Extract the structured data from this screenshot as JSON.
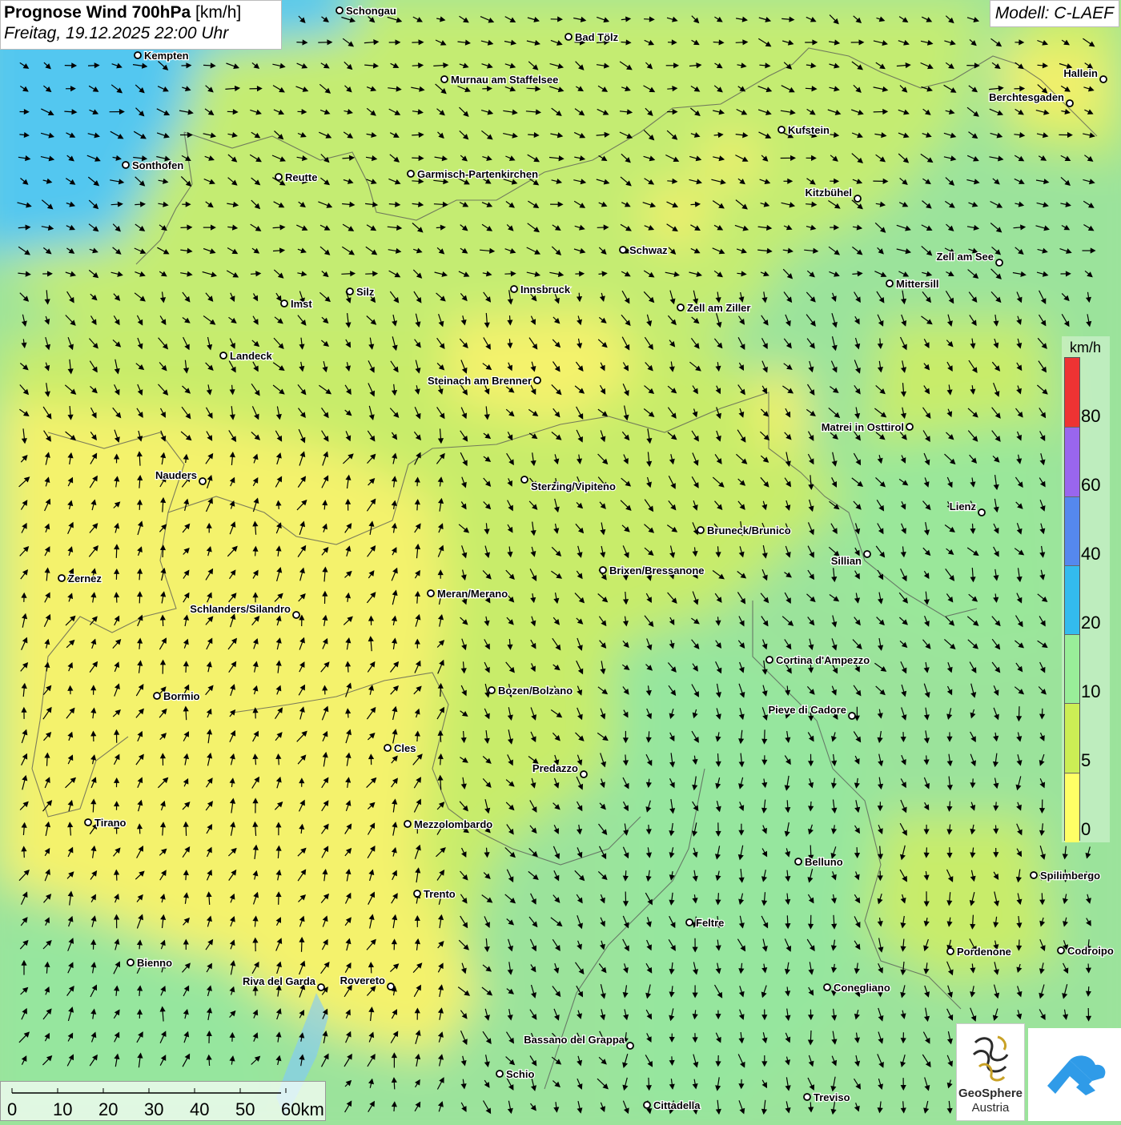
{
  "title": {
    "main": "Prognose Wind 700hPa",
    "unit": "[km/h]",
    "date": "Freitag, 19.12.2025 22:00 Uhr"
  },
  "model": "Modell: C-LAEF",
  "legend": {
    "unit": "km/h",
    "labels": [
      "80",
      "60",
      "40",
      "20",
      "10",
      "5",
      "0"
    ],
    "colors": [
      "#ee3333",
      "#9966ee",
      "#5588ee",
      "#33bbee",
      "#99ee99",
      "#ccee55",
      "#ffff66"
    ]
  },
  "scale_bar": {
    "labels": [
      "0",
      "10",
      "20",
      "30",
      "40",
      "50",
      "60km"
    ]
  },
  "logo": {
    "line1": "GeoSphere",
    "line2": "Austria"
  },
  "colors": {
    "calm": "#f5f36e",
    "light": "#c8ec6a",
    "moderate": "#9ae79a",
    "fresh": "#52c7f0"
  },
  "cities": [
    {
      "name": "Schongau"
    },
    {
      "name": "Bad Tölz"
    },
    {
      "name": "Kempten"
    },
    {
      "name": "Murnau am Staffelsee"
    },
    {
      "name": "Hallein"
    },
    {
      "name": "Berchtesgaden"
    },
    {
      "name": "Kufstein"
    },
    {
      "name": "Sonthofen"
    },
    {
      "name": "Reutte"
    },
    {
      "name": "Garmisch-Partenkirchen"
    },
    {
      "name": "Kitzbühel"
    },
    {
      "name": "Schwaz"
    },
    {
      "name": "Zell am See"
    },
    {
      "name": "Innsbruck"
    },
    {
      "name": "Mittersill"
    },
    {
      "name": "Imst"
    },
    {
      "name": "Silz"
    },
    {
      "name": "Zell am Ziller"
    },
    {
      "name": "Landeck"
    },
    {
      "name": "Steinach am Brenner"
    },
    {
      "name": "Matrei in Osttirol"
    },
    {
      "name": "Nauders"
    },
    {
      "name": "Sterzing/Vipiteno"
    },
    {
      "name": "Lienz"
    },
    {
      "name": "Bruneck/Brunico"
    },
    {
      "name": "Sillian"
    },
    {
      "name": "Brixen/Bressanone"
    },
    {
      "name": "Zernez"
    },
    {
      "name": "Meran/Merano"
    },
    {
      "name": "Schlanders/Silandro"
    },
    {
      "name": "Cortina d'Ampezzo"
    },
    {
      "name": "Bozen/Bolzano"
    },
    {
      "name": "Bormio"
    },
    {
      "name": "Pieve di Cadore"
    },
    {
      "name": "Cles"
    },
    {
      "name": "Predazzo"
    },
    {
      "name": "Tirano"
    },
    {
      "name": "Mezzolombardo"
    },
    {
      "name": "Belluno"
    },
    {
      "name": "Spilimbergo"
    },
    {
      "name": "Trento"
    },
    {
      "name": "Feltre"
    },
    {
      "name": "Pordenone"
    },
    {
      "name": "Codroipo"
    },
    {
      "name": "Bienno"
    },
    {
      "name": "Riva del Garda"
    },
    {
      "name": "Rovereto"
    },
    {
      "name": "Conegliano"
    },
    {
      "name": "Bassano del Grappa"
    },
    {
      "name": "Schio"
    },
    {
      "name": "Treviso"
    },
    {
      "name": "Cittadella"
    }
  ]
}
